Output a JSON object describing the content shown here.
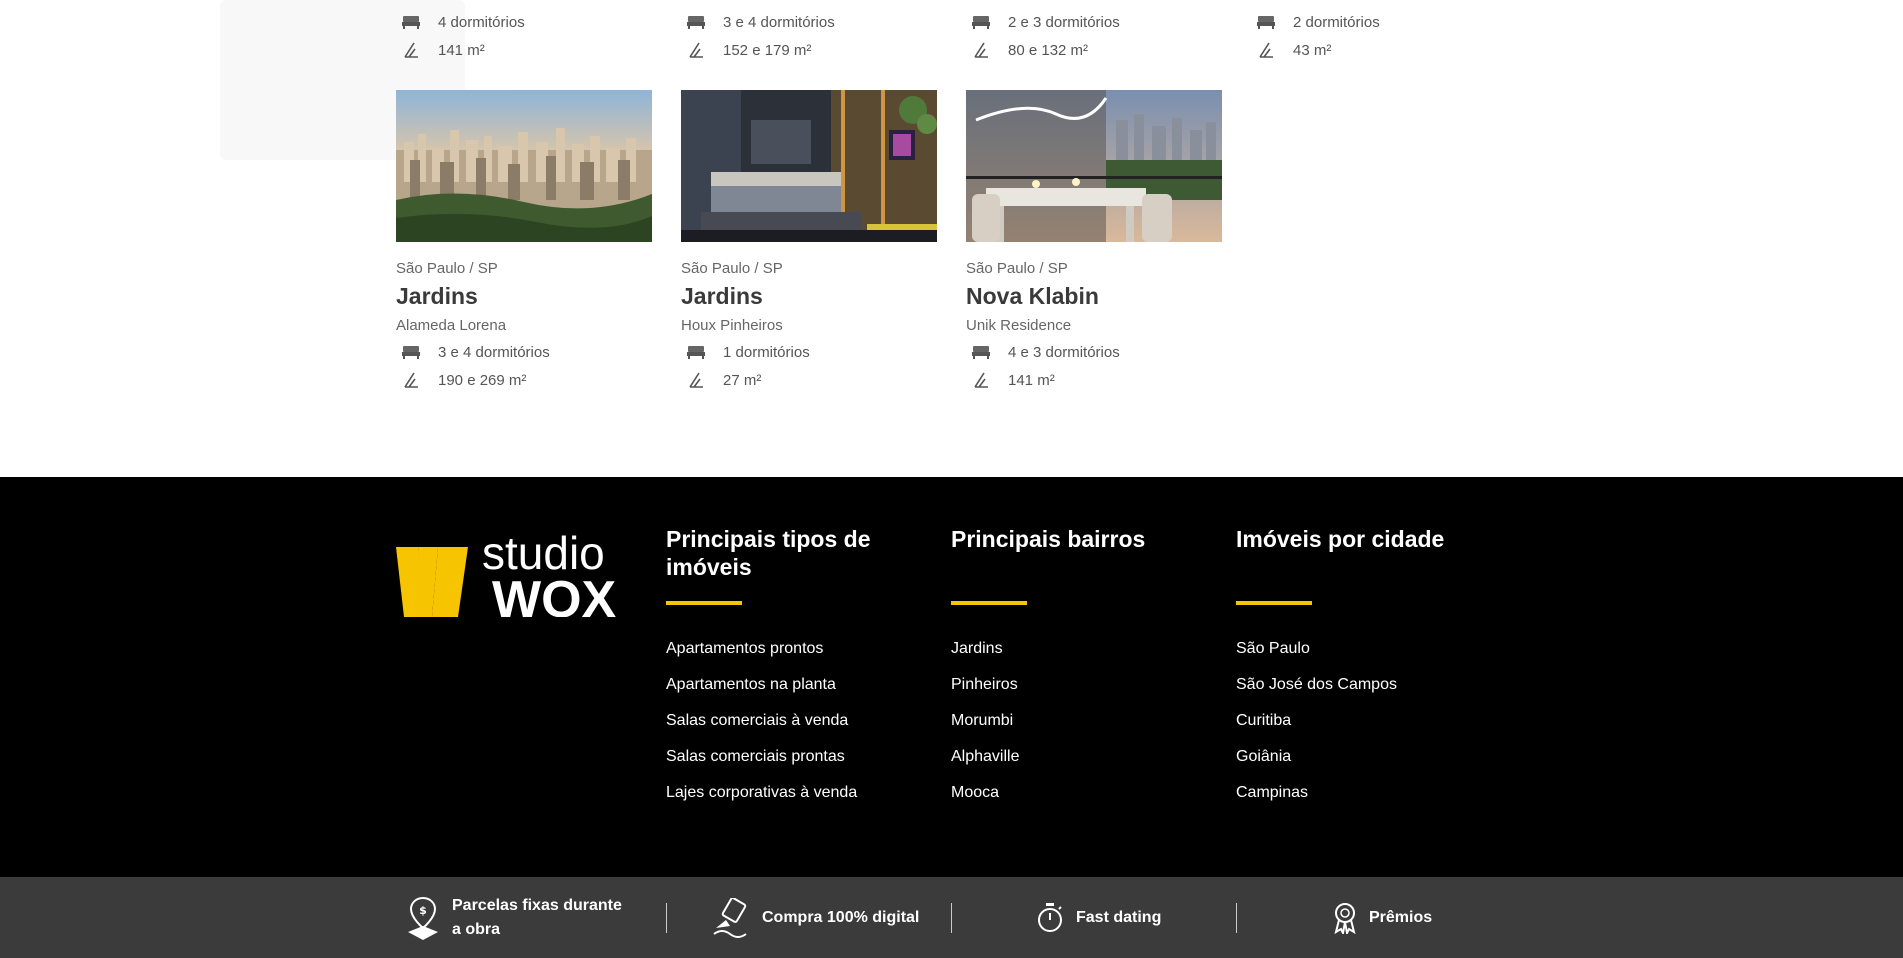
{
  "top_row": [
    {
      "bedrooms": "4 dormitórios",
      "area": "141 m²"
    },
    {
      "bedrooms": "3 e 4 dormitórios",
      "area": "152 e 179 m²"
    },
    {
      "bedrooms": "2 e 3 dormitórios",
      "area": "80 e 132 m²"
    },
    {
      "bedrooms": "2 dormitórios",
      "area": "43 m²"
    }
  ],
  "cards": [
    {
      "city": "São Paulo / SP",
      "neighborhood": "Jardins",
      "project": "Alameda Lorena",
      "bedrooms": "3 e 4 dormitórios",
      "area": "190 e 269 m²",
      "image": "city-skyline-photo"
    },
    {
      "city": "São Paulo / SP",
      "neighborhood": "Jardins",
      "project": "Houx Pinheiros",
      "bedrooms": "1 dormitórios",
      "area": "27 m²",
      "image": "bedroom-interior-photo"
    },
    {
      "city": "São Paulo / SP",
      "neighborhood": "Nova Klabin",
      "project": "Unik Residence",
      "bedrooms": "4 e 3 dormitórios",
      "area": "141 m²",
      "image": "dining-balcony-photo"
    }
  ],
  "footer": {
    "logo_top": "studio",
    "logo_bottom": "WOX",
    "columns": [
      {
        "title": "Principais tipos de imóveis",
        "links": [
          "Apartamentos prontos",
          "Apartamentos na planta",
          "Salas comerciais à venda",
          "Salas comerciais prontas",
          "Lajes corporativas à venda"
        ]
      },
      {
        "title": "Principais bairros",
        "links": [
          "Jardins",
          "Pinheiros",
          "Morumbi",
          "Alphaville",
          "Mooca"
        ]
      },
      {
        "title": "Imóveis por cidade",
        "links": [
          "São Paulo",
          "São José dos Campos",
          "Curitiba",
          "Goiânia",
          "Campinas"
        ]
      }
    ]
  },
  "benefits": [
    {
      "label": "Parcelas fixas durante a obra",
      "icon": "map-pin-money-icon"
    },
    {
      "label": "Compra 100% digital",
      "icon": "digital-signature-icon"
    },
    {
      "label": "Fast dating",
      "icon": "stopwatch-icon"
    },
    {
      "label": "Prêmios",
      "icon": "award-ribbon-icon"
    }
  ],
  "colors": {
    "accent": "#f6c400",
    "footer_bg": "#000000",
    "benefits_bg": "#3b3b3b"
  }
}
